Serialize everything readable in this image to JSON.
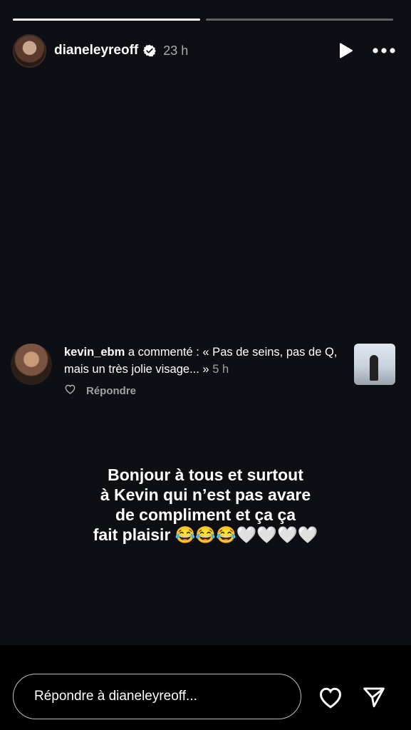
{
  "progress": [
    1.0,
    0.0
  ],
  "header": {
    "username": "dianeleyreoff",
    "time": "23 h",
    "icons": [
      "verified-badge-icon",
      "play-icon",
      "more-icon"
    ]
  },
  "comment": {
    "username": "kevin_ebm",
    "action": " a commenté : « Pas de seins, pas de Q, mais un très jolie visage... » ",
    "time": "5 h",
    "reply_label": "Répondre",
    "icons": [
      "heart-outline-icon"
    ]
  },
  "caption": {
    "lines": [
      "Bonjour à tous et surtout",
      "à Kevin qui n’est pas avare",
      "de compliment et ça ça",
      "fait plaisir 😂😂😂🤍🤍🤍🤍"
    ]
  },
  "footer": {
    "reply_placeholder": "Répondre à dianeleyreoff...",
    "icons": [
      "heart-icon",
      "send-icon"
    ]
  },
  "colors": {
    "background": "#0d0f14",
    "footer": "#000000",
    "text": "#ffffff"
  }
}
